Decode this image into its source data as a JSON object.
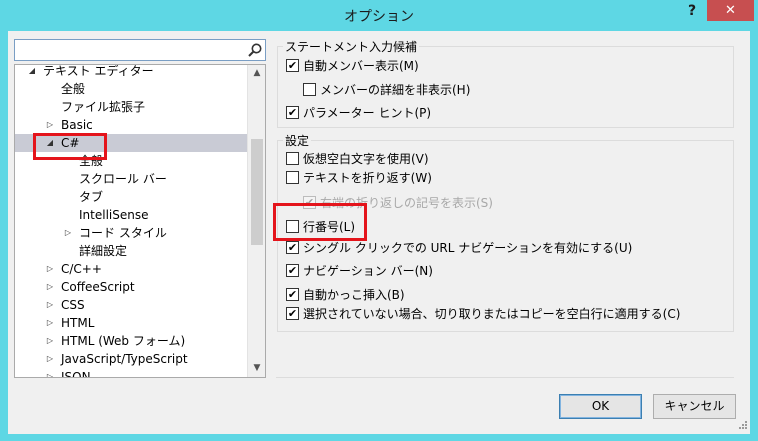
{
  "window": {
    "title": "オプション",
    "help_label": "?",
    "close_label": "✕"
  },
  "search": {
    "placeholder": "",
    "value": ""
  },
  "tree": {
    "items": [
      {
        "label": "テキスト エディター",
        "expander": "◢",
        "level": 0
      },
      {
        "label": "全般",
        "expander": "",
        "level": 1
      },
      {
        "label": "ファイル拡張子",
        "expander": "",
        "level": 1
      },
      {
        "label": "Basic",
        "expander": "▷",
        "level": 1
      },
      {
        "label": "C#",
        "expander": "◢",
        "level": 1,
        "selected": true
      },
      {
        "label": "全般",
        "expander": "",
        "level": 2
      },
      {
        "label": "スクロール バー",
        "expander": "",
        "level": 2
      },
      {
        "label": "タブ",
        "expander": "",
        "level": 2
      },
      {
        "label": "IntelliSense",
        "expander": "",
        "level": 2
      },
      {
        "label": "コード スタイル",
        "expander": "▷",
        "level": 2
      },
      {
        "label": "詳細設定",
        "expander": "",
        "level": 2
      },
      {
        "label": "C/C++",
        "expander": "▷",
        "level": 1
      },
      {
        "label": "CoffeeScript",
        "expander": "▷",
        "level": 1
      },
      {
        "label": "CSS",
        "expander": "▷",
        "level": 1
      },
      {
        "label": "HTML",
        "expander": "▷",
        "level": 1
      },
      {
        "label": "HTML (Web フォーム)",
        "expander": "▷",
        "level": 1
      },
      {
        "label": "JavaScript/TypeScript",
        "expander": "▷",
        "level": 1
      },
      {
        "label": "JSON",
        "expander": "▷",
        "level": 1
      }
    ]
  },
  "statement_completion": {
    "title": "ステートメント入力候補",
    "options": [
      {
        "label": "自動メンバー表示(M)",
        "checked": true
      },
      {
        "label": "メンバーの詳細を非表示(H)",
        "checked": false
      },
      {
        "label": "パラメーター ヒント(P)",
        "checked": true
      }
    ]
  },
  "settings": {
    "title": "設定",
    "options": [
      {
        "label": "仮想空白文字を使用(V)",
        "checked": false
      },
      {
        "label": "テキストを折り返す(W)",
        "checked": false
      },
      {
        "label": "右端の折り返しの記号を表示(S)",
        "checked": true,
        "disabled": true
      },
      {
        "label": "行番号(L)",
        "checked": false
      },
      {
        "label": "シングル クリックでの URL ナビゲーションを有効にする(U)",
        "checked": true
      },
      {
        "label": "ナビゲーション バー(N)",
        "checked": true
      },
      {
        "label": "自動かっこ挿入(B)",
        "checked": true
      },
      {
        "label": "選択されていない場合、切り取りまたはコピーを空白行に適用する(C)",
        "checked": true
      }
    ]
  },
  "buttons": {
    "ok": "OK",
    "cancel": "キャンセル"
  },
  "check_mark": "✔",
  "scroll": {
    "up": "▲",
    "down": "▼"
  },
  "colors": {
    "titlebar": "#5ed7e4",
    "close": "#c74f50",
    "highlight": "#e4141b",
    "selection": "#c9cbd5"
  }
}
